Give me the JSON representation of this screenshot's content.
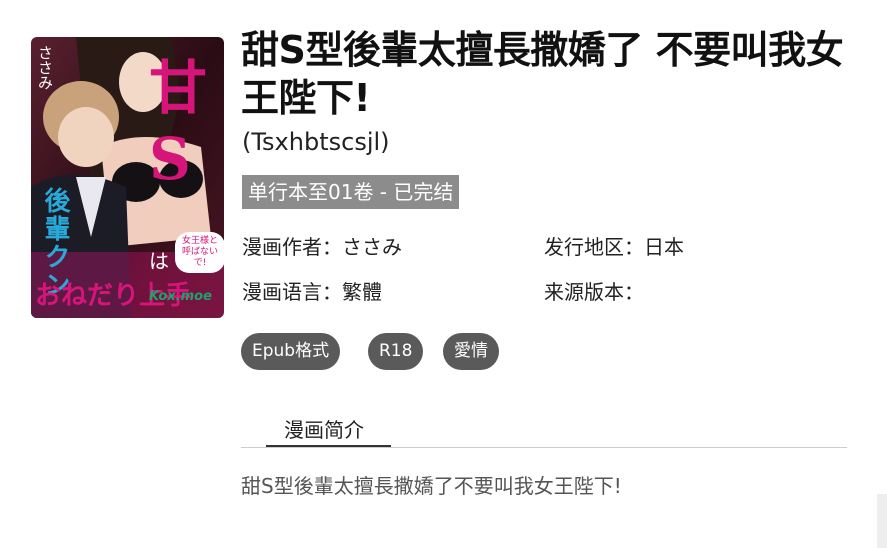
{
  "comic": {
    "title": "甜S型後輩太擅長撒嬌了 不要叫我女王陛下!",
    "subtitle": "(Tsxhbtscsjl)",
    "status": "单行本至01卷 - 已完结",
    "author_label": "漫画作者：",
    "author": "ささみ",
    "region_label": "发行地区：",
    "region": "日本",
    "language_label": "漫画语言：",
    "language": "繁體",
    "source_label": "来源版本：",
    "source": ""
  },
  "cover": {
    "title_glyph": "甘S",
    "author_vertical": "ささみ",
    "main_vertical": "後輩クン",
    "line_wa": "は",
    "line_bottom": "おねだり上手",
    "speech": "女王様と呼ばないで!",
    "watermark": "Kox.moe",
    "colors": {
      "bg": "#3a1420",
      "accent": "#d6157a",
      "skin": "#f1d2bf",
      "hair": "#c7a27a"
    }
  },
  "tags": [
    "Epub格式",
    "R18",
    "愛情"
  ],
  "tabs": {
    "intro": "漫画简介"
  },
  "description": "甜S型後輩太擅長撒嬌了不要叫我女王陛下!"
}
